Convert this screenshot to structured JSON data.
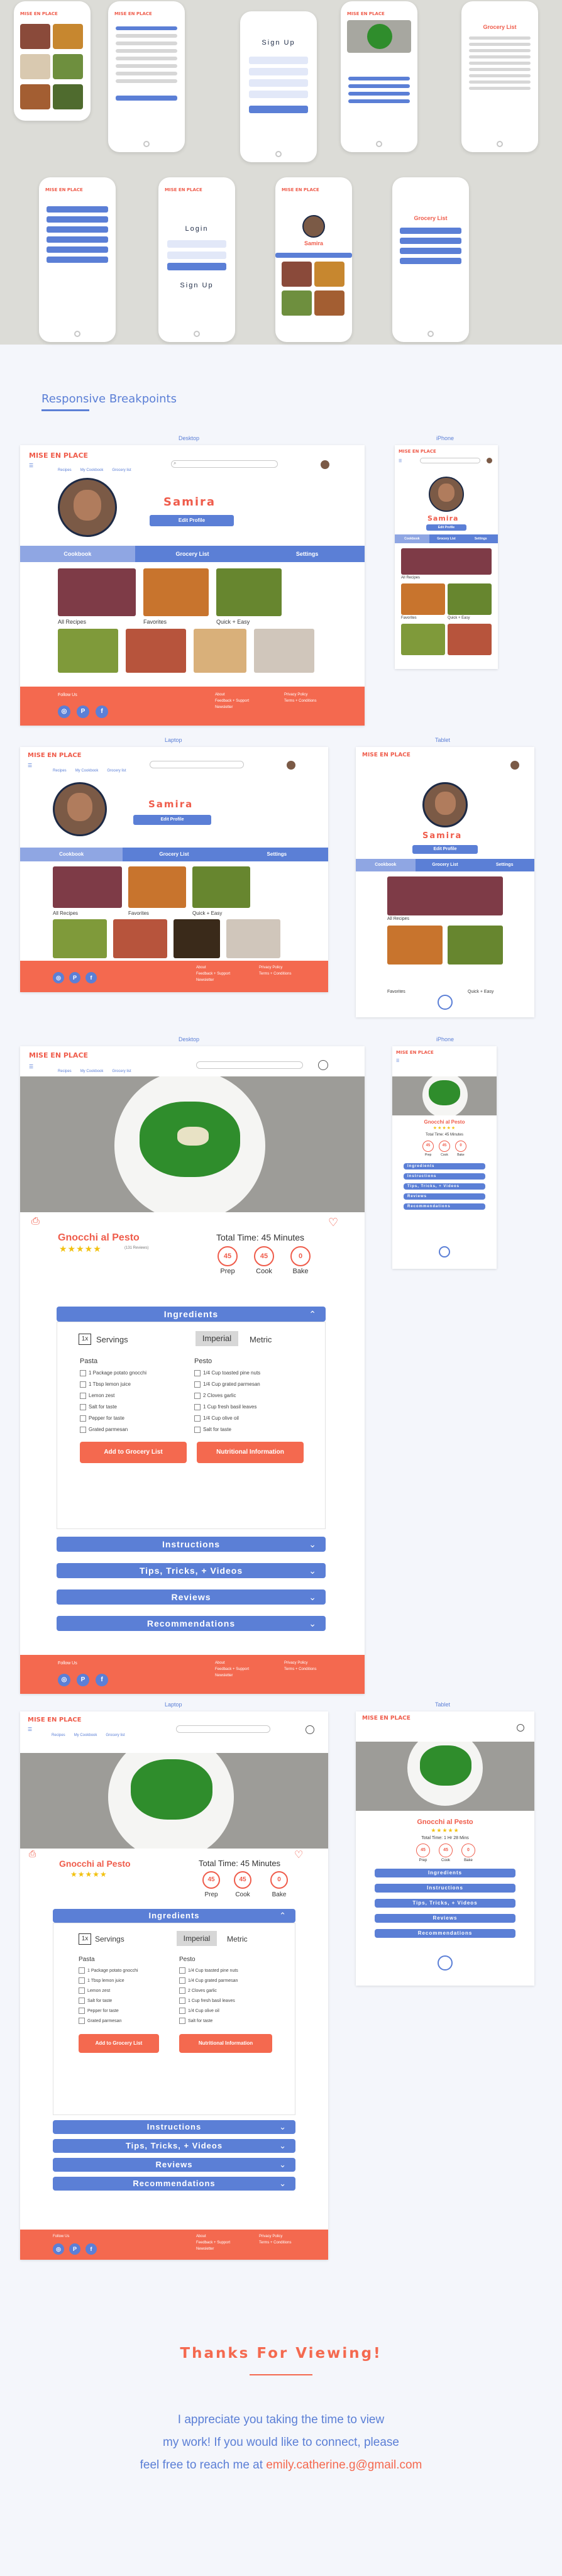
{
  "brand": {
    "logo": "MISE EN PLACE",
    "accent": "#ef5c4b",
    "primary": "#5b7fd6",
    "footer": "#f4694f"
  },
  "nav": {
    "recipes": "Recipes",
    "my_cookbook": "My Cookbook",
    "grocery_list": "Grocery list"
  },
  "mobile_screens": {
    "signup_title": "Sign Up",
    "login_title": "Login",
    "grocery_title": "Grocery List",
    "name": "Samira"
  },
  "section": {
    "title": "Responsive Breakpoints"
  },
  "labels": {
    "desktop": "Desktop",
    "iphone": "iPhone",
    "laptop": "Laptop",
    "tablet": "Tablet"
  },
  "profile": {
    "name": "Samira",
    "edit": "Edit Profile",
    "tabs": [
      "Cookbook",
      "Grocery List",
      "Settings"
    ],
    "categories": [
      "All Recipes",
      "Favorites",
      "Quick + Easy"
    ]
  },
  "footer": {
    "follow": "Follow Us",
    "about": "About",
    "feedback": "Feedback + Support",
    "newsletter": "Newsletter",
    "privacy": "Privacy Policy",
    "terms": "Terms + Conditions"
  },
  "recipe": {
    "title": "Gnocchi al Pesto",
    "reviews": "(131 Reviews)",
    "total_time": "Total Time: 45 Minutes",
    "prep": "Prep",
    "cook": "Cook",
    "bake": "Bake",
    "prep_val": "45",
    "cook_val": "45",
    "bake_val": "0",
    "stars": "★★★★★",
    "tablet_time": "Total Time: 1 Hr 28 Mins"
  },
  "ingredients": {
    "heading": "Ingredients",
    "servings_qty": "1x",
    "servings": "Servings",
    "imperial": "Imperial",
    "metric": "Metric",
    "pasta": "Pasta",
    "pesto": "Pesto",
    "pasta_items": [
      "1 Package potato gnocchi",
      "1 Tbsp lemon juice",
      "Lemon zest",
      "Salt for taste",
      "Pepper for taste",
      "Grated parmesan"
    ],
    "pesto_items": [
      "1/4 Cup toasted pine nuts",
      "1/4 Cup grated parmesan",
      "2 Cloves garlic",
      "1 Cup fresh basil leaves",
      "1/4 Cup olive oil",
      "Salt for taste"
    ],
    "add_btn": "Add to Grocery List",
    "nutrition_btn": "Nutritional Information"
  },
  "sections": [
    "Instructions",
    "Tips, Tricks, + Videos",
    "Reviews",
    "Recommendations"
  ],
  "closing": {
    "thanks": "Thanks For Viewing!",
    "line1": "I appreciate you taking the time to view",
    "line2": "my work! If you would like to connect, please",
    "line3_pre": "feel free to reach me at ",
    "email": "emily.catherine.g@gmail.com"
  }
}
